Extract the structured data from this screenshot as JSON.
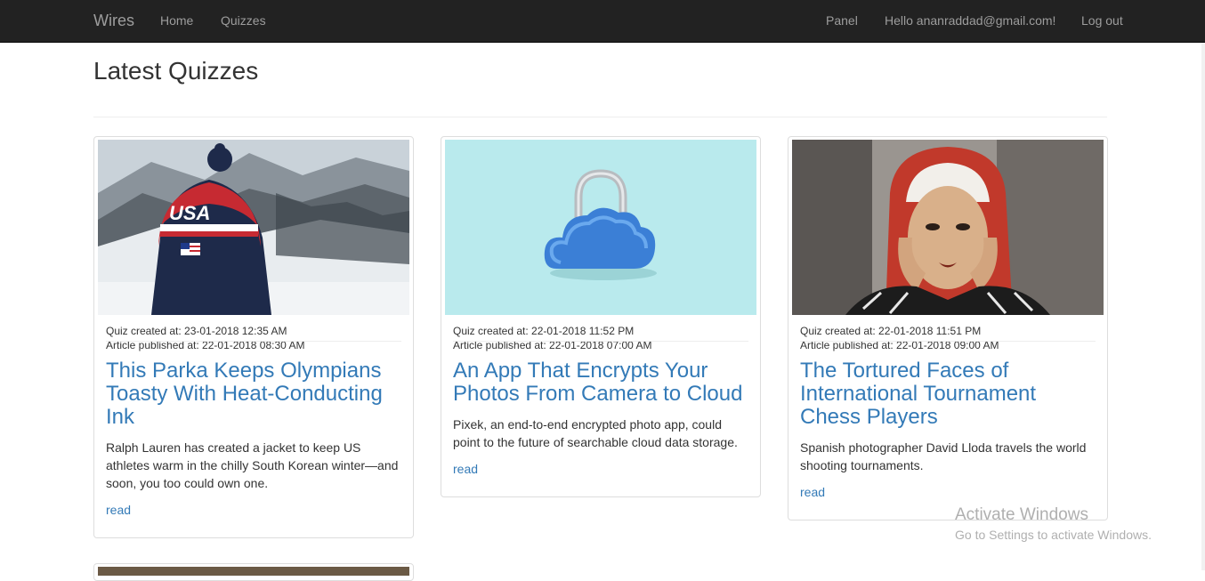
{
  "nav": {
    "brand": "Wires",
    "home": "Home",
    "quizzes": "Quizzes",
    "panel": "Panel",
    "greeting": "Hello ananraddad@gmail.com!",
    "logout": "Log out"
  },
  "page": {
    "title": "Latest Quizzes"
  },
  "cards": [
    {
      "quiz_created": "Quiz created at: 23-01-2018 12:35 AM",
      "article_published": "Article published at: 22-01-2018 08:30 AM",
      "title": "This Parka Keeps Olympians Toasty With Heat-Conducting Ink",
      "description": "Ralph Lauren has created a jacket to keep US athletes warm in the chilly South Korean winter—and soon, you too could own one.",
      "read": "read",
      "image_label": "USA"
    },
    {
      "quiz_created": "Quiz created at: 22-01-2018 11:52 PM",
      "article_published": "Article published at: 22-01-2018 07:00 AM",
      "title": "An App That Encrypts Your Photos From Camera to Cloud",
      "description": "Pixek, an end-to-end encrypted photo app, could point to the future of searchable cloud data storage.",
      "read": "read"
    },
    {
      "quiz_created": "Quiz created at: 22-01-2018 11:51 PM",
      "article_published": "Article published at: 22-01-2018 09:00 AM",
      "title": "The Tortured Faces of International Tournament Chess Players",
      "description": "Spanish photographer David Lloda travels the world shooting tournaments.",
      "read": "read"
    }
  ],
  "watermark": {
    "title": "Activate Windows",
    "subtitle": "Go to Settings to activate Windows."
  },
  "colors": {
    "navbar": "#222222",
    "nav_text": "#9d9d9d",
    "link": "#337ab7",
    "card_border": "#dddddd"
  }
}
